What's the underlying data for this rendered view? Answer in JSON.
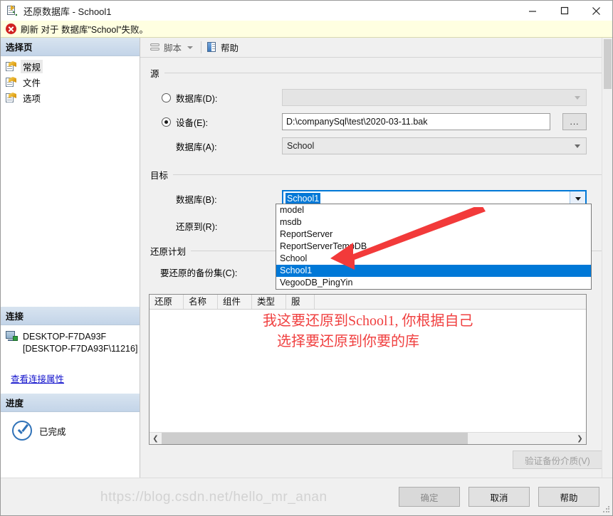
{
  "window": {
    "title": "还原数据库 - School1",
    "icon": "restore-database-icon",
    "minimize": "—",
    "maximize": "□",
    "close": "✕"
  },
  "error_banner": {
    "icon": "error-circle-icon",
    "text": "刷新 对于 数据库\"School\"失败。"
  },
  "sidebar": {
    "select_page_header": "选择页",
    "pages": [
      {
        "label": "常规",
        "selected": true
      },
      {
        "label": "文件",
        "selected": false
      },
      {
        "label": "选项",
        "selected": false
      }
    ],
    "connection_header": "连接",
    "server_name": "DESKTOP-F7DA93F",
    "server_instance": "[DESKTOP-F7DA93F\\11216]",
    "connection_link": "查看连接属性",
    "progress_header": "进度",
    "progress_status": "已完成"
  },
  "toolbar": {
    "script_label": "脚本",
    "help_label": "帮助"
  },
  "source": {
    "group_title": "源",
    "database_radio_label": "数据库(D):",
    "database_radio_selected": false,
    "database_value": "",
    "device_radio_label": "设备(E):",
    "device_radio_selected": true,
    "device_path": "D:\\companySql\\test\\2020-03-11.bak",
    "browse_button": "...",
    "source_db_label": "数据库(A):",
    "source_db_value": "School"
  },
  "target": {
    "group_title": "目标",
    "database_label": "数据库(B):",
    "database_value": "School1",
    "restore_to_label": "还原到(R):",
    "restore_to_value": "",
    "dropdown_open": true,
    "dropdown_items": [
      "model",
      "msdb",
      "ReportServer",
      "ReportServerTempDB",
      "School",
      "School1",
      "VegooDB_PingYin"
    ],
    "dropdown_selected": "School1"
  },
  "restore_plan": {
    "group_title": "还原计划",
    "backup_sets_label": "要还原的备份集(C):",
    "columns": [
      "还原",
      "名称",
      "组件",
      "类型",
      "服"
    ],
    "rows": []
  },
  "buttons": {
    "verify_media": "验证备份介质(V)",
    "ok": "确定",
    "cancel": "取消",
    "help": "帮助"
  },
  "annotation": {
    "line1": "我这要还原到School1, 你根据自己",
    "line2": "选择要还原到你要的库",
    "color": "#f04040",
    "arrow": "red-arrow-pointing-to-School1"
  },
  "watermark": "https://blog.csdn.net/hello_mr_anan"
}
